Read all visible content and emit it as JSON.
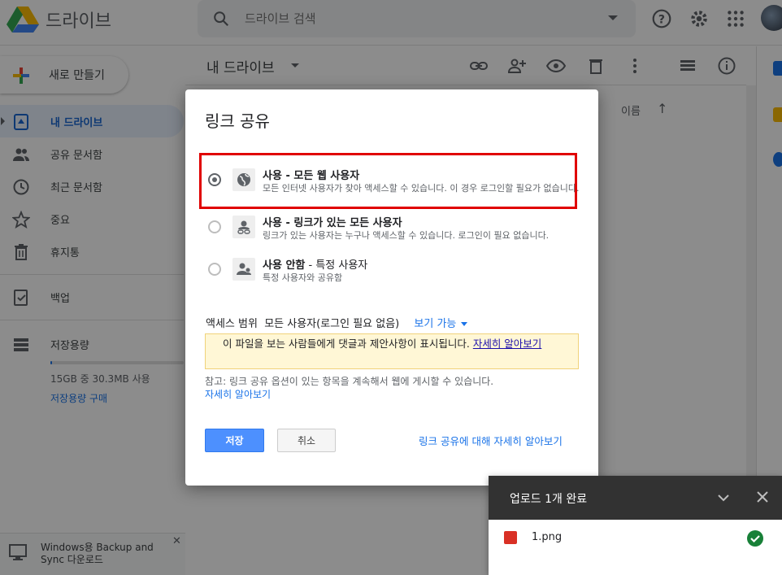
{
  "app": {
    "brand": "드라이브"
  },
  "search": {
    "placeholder": "드라이브 검색"
  },
  "sidebar": {
    "new_label": "새로 만들기",
    "items": [
      {
        "label": "내 드라이브",
        "icon": "drive-icon",
        "active": true
      },
      {
        "label": "공유 문서함",
        "icon": "people-icon"
      },
      {
        "label": "최근 문서함",
        "icon": "clock-icon"
      },
      {
        "label": "중요",
        "icon": "star-icon"
      },
      {
        "label": "휴지통",
        "icon": "trash-icon"
      },
      {
        "label": "백업",
        "icon": "backup-icon"
      },
      {
        "label": "저장용량",
        "icon": "storage-icon"
      }
    ],
    "storage_text": "15GB 중 30.3MB 사용",
    "storage_fraction": 0.002,
    "storage_buy": "저장용량 구매",
    "backup_notice": "Windows용 Backup and Sync 다운로드"
  },
  "main": {
    "title": "내 드라이브",
    "sort_label": "이름"
  },
  "dialog": {
    "title": "링크 공유",
    "options": [
      {
        "title_bold": "사용 - 모든 웹 사용자",
        "desc": "모든 인터넷 사용자가 찾아 액세스할 수 있습니다. 이 경우 로그인할 필요가 없습니다.",
        "icon": "globe-icon",
        "checked": true
      },
      {
        "title_bold": "사용 - 링크가 있는 모든 사용자",
        "desc": "링크가 있는 사용자는 누구나 액세스할 수 있습니다. 로그인이 필요 없습니다.",
        "icon": "link-user-icon",
        "checked": false
      },
      {
        "title_bold": "사용 안함",
        "title_rest": " - 특정 사용자",
        "desc": "특정 사용자와 공유함",
        "icon": "people-icon",
        "checked": false
      }
    ],
    "scope_label": "액세스 범위  모든 사용자(로그인 필요 없음)",
    "scope_permission": "보기 가능",
    "warning": "이 파일을 보는 사람들에게 댓글과 제안사항이 표시됩니다.",
    "warning_link": "자세히 알아보기",
    "note": "참고: 링크 공유 옵션이 있는 항목을 계속해서 웹에 게시할 수 있습니다.",
    "note_link": "자세히 알아보기",
    "save_label": "저장",
    "cancel_label": "취소",
    "learn_more": "링크 공유에 대해 자세히 알아보기"
  },
  "upload": {
    "title": "업로드 1개 완료",
    "file_name": "1.png"
  },
  "colors": {
    "accent": "#1a73e8",
    "highlight": "#e00000",
    "save": "#4d90fe"
  }
}
